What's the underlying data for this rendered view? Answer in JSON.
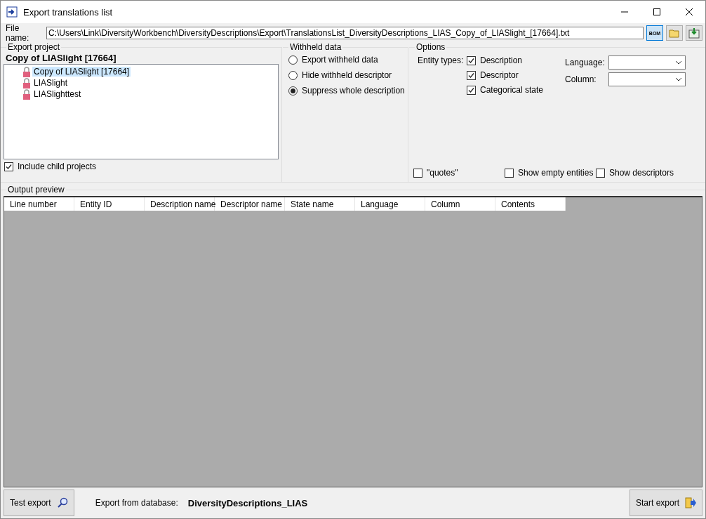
{
  "window": {
    "title": "Export translations list"
  },
  "file_name": {
    "label": "File name:",
    "value": "C:\\Users\\Link\\DiversityWorkbench\\DiversityDescriptions\\Export\\TranslationsList_DiversityDescriptions_LIAS_Copy_of_LIASlight_[17664].txt",
    "bom_button": "BOM"
  },
  "export_project": {
    "legend": "Export project",
    "current": "Copy of LIASlight [17664]",
    "items": [
      {
        "label": "Copy of LIASlight [17664]",
        "selected": true
      },
      {
        "label": "LIASlight",
        "selected": false
      },
      {
        "label": "LIASlighttest",
        "selected": false
      }
    ],
    "include_child": {
      "label": "Include child projects",
      "checked": true
    }
  },
  "withheld_data": {
    "legend": "Withheld data",
    "options": [
      {
        "label": "Export withheld data",
        "selected": false
      },
      {
        "label": "Hide withheld descriptor",
        "selected": false
      },
      {
        "label": "Suppress whole description",
        "selected": true
      }
    ]
  },
  "options": {
    "legend": "Options",
    "entity_types_label": "Entity types:",
    "entity_types": [
      {
        "label": "Description",
        "checked": true
      },
      {
        "label": "Descriptor",
        "checked": true
      },
      {
        "label": "Categorical state",
        "checked": true
      }
    ],
    "language": {
      "label": "Language:"
    },
    "column": {
      "label": "Column:"
    },
    "flags": [
      {
        "label": "\"quotes\"",
        "checked": false
      },
      {
        "label": "Show empty entities",
        "checked": false
      },
      {
        "label": "Show descriptors",
        "checked": false
      }
    ]
  },
  "output_preview": {
    "legend": "Output preview",
    "columns": [
      "Line number",
      "Entity ID",
      "Description name",
      "Descriptor name",
      "State name",
      "Language",
      "Column",
      "Contents"
    ]
  },
  "footer": {
    "test_button": "Test export",
    "database_label": "Export from database:",
    "database_name": "DiversityDescriptions_LIAS",
    "start_button": "Start export"
  }
}
